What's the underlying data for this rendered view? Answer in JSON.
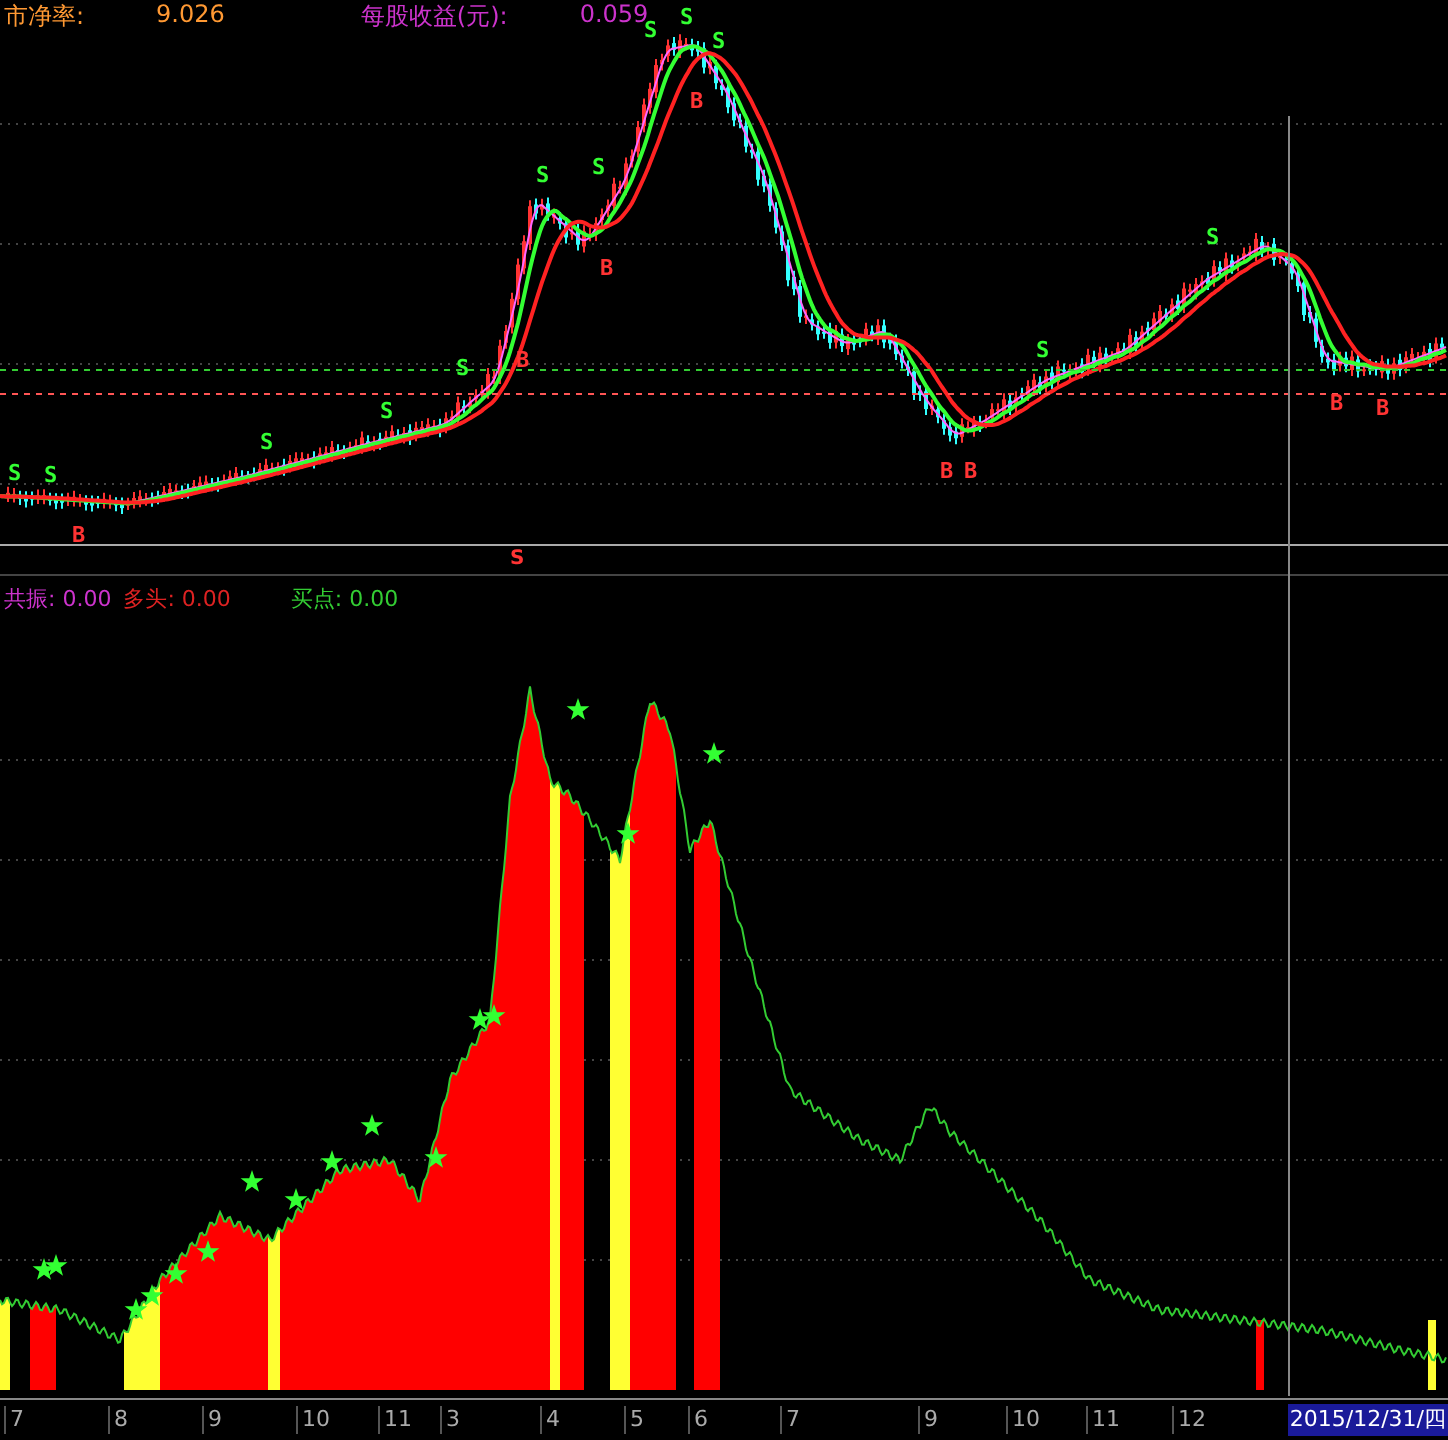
{
  "header": [
    {
      "label": "市净率:",
      "value": "9.026",
      "color": "#ff9933"
    },
    {
      "label": "每股收益(元):",
      "value": "0.059",
      "color": "#cc33cc"
    }
  ],
  "price_signals": [
    {
      "label": "S"
    },
    {
      "label": "S"
    },
    {
      "label": "S"
    },
    {
      "label": "S"
    },
    {
      "label": "S"
    },
    {
      "label": "S"
    },
    {
      "label": "S"
    },
    {
      "label": "S"
    },
    {
      "label": "S"
    },
    {
      "label": "S"
    },
    {
      "label": "S"
    },
    {
      "label": "S"
    },
    {
      "label": "B"
    },
    {
      "label": "B"
    },
    {
      "label": "B"
    },
    {
      "label": "B"
    },
    {
      "label": "B"
    },
    {
      "label": "B"
    },
    {
      "label": "B"
    },
    {
      "label": "B"
    }
  ],
  "panel_signal": "S",
  "legend": [
    {
      "label": "共振:",
      "value": "0.00",
      "color": "#cc33cc"
    },
    {
      "label": "多头:",
      "value": "0.00",
      "color": "#dd2222"
    },
    {
      "label": "买点:",
      "value": "0.00",
      "color": "#33cc33"
    }
  ],
  "time_axis": {
    "labels": [
      "7",
      "8",
      "9",
      "10",
      "11",
      "3",
      "4",
      "5",
      "6",
      "7",
      "9",
      "10",
      "11",
      "12"
    ],
    "cursor_date": "2015/12/31/四"
  }
}
